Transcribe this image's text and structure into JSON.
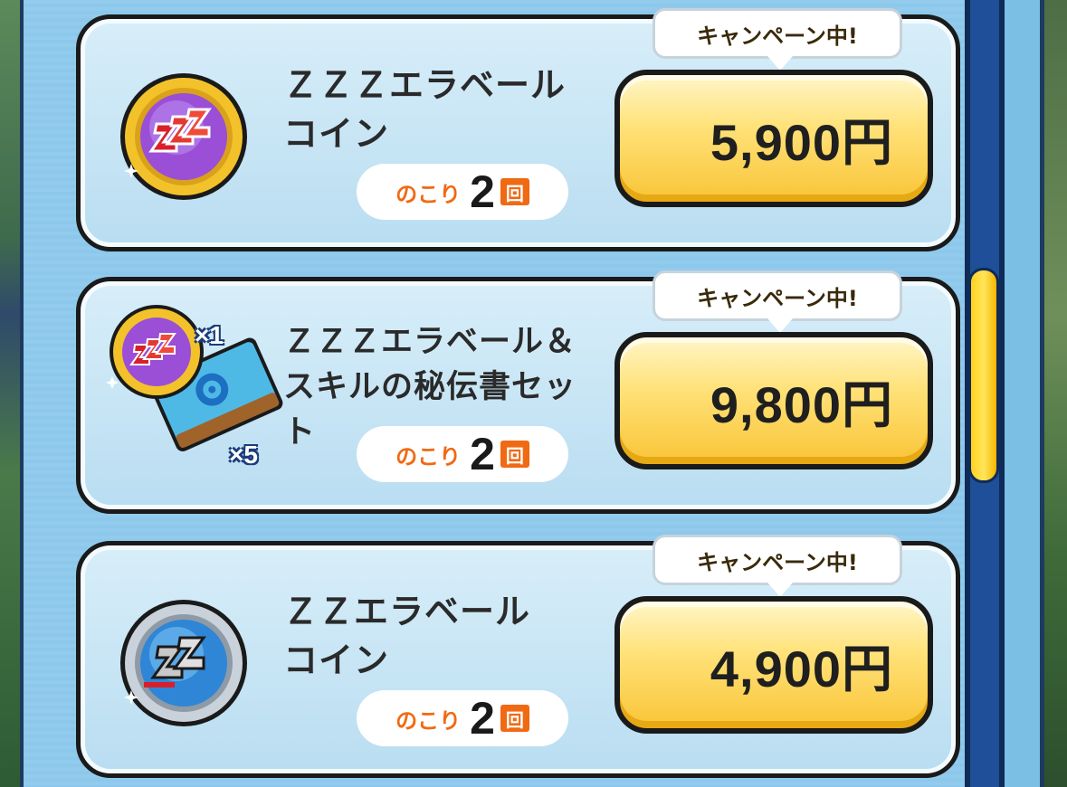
{
  "campaign_label": "キャンペーン中!",
  "items": [
    {
      "name": "ＺＺＺエラベール\nコイン",
      "remaining_prefix": "のこり",
      "remaining_count": "2",
      "remaining_unit": "回",
      "price": "5,900円",
      "icon": "zzz-gold-coin-icon"
    },
    {
      "name": "ＺＺＺエラベール＆\nスキルの秘伝書セット",
      "remaining_prefix": "のこり",
      "remaining_count": "2",
      "remaining_unit": "回",
      "price": "9,800円",
      "icon": "zzz-coin-and-skill-book-icon",
      "coin_qty": "×1",
      "book_qty": "×5"
    },
    {
      "name": "ＺＺエラベール\nコイン",
      "remaining_prefix": "のこり",
      "remaining_count": "2",
      "remaining_unit": "回",
      "price": "4,900円",
      "icon": "zz-silver-coin-icon"
    }
  ],
  "colors": {
    "panel_bg": "#8cc8ec",
    "price_button": "#ffe27a",
    "remaining_accent": "#f06a14",
    "scroll_thumb": "#ffd21f"
  }
}
